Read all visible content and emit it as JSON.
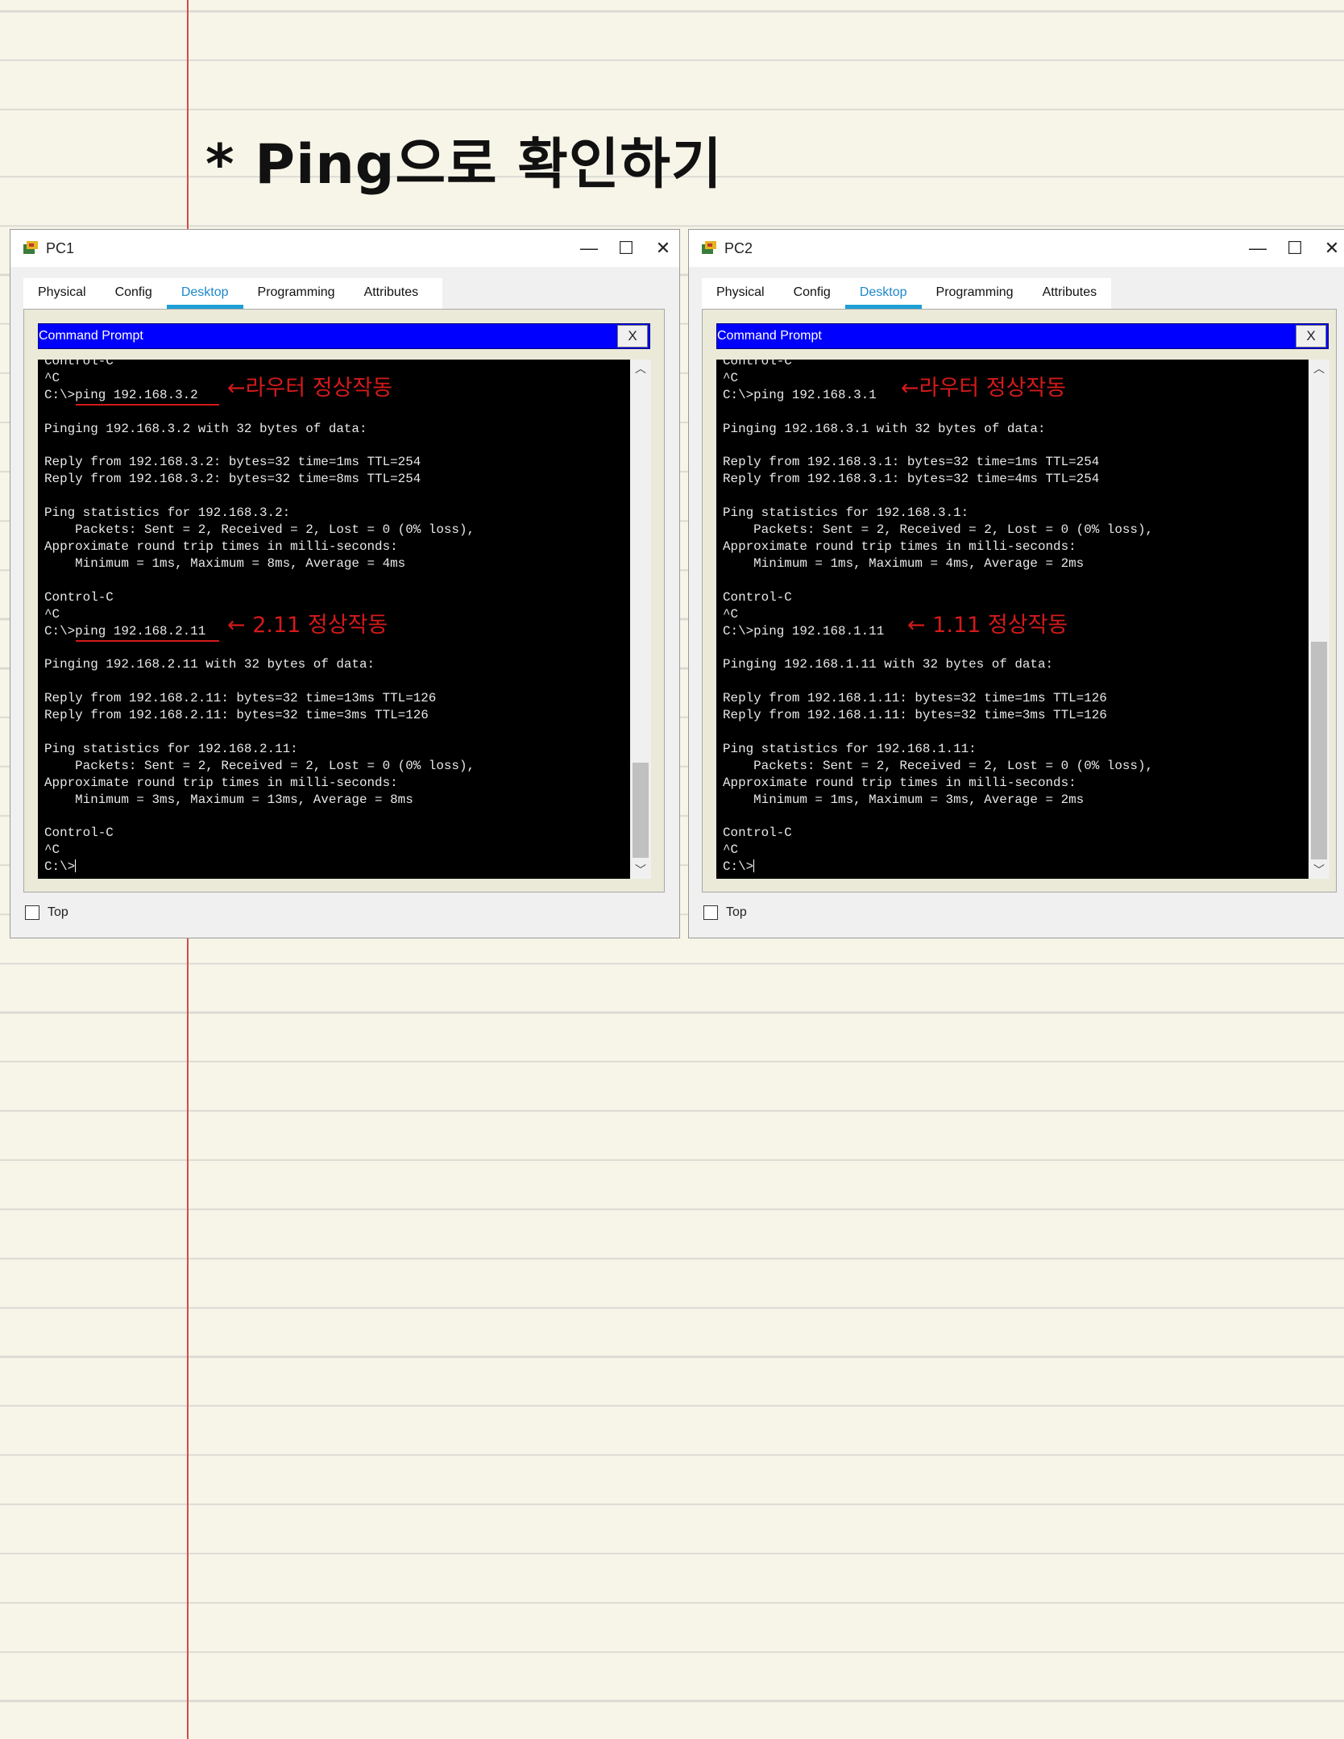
{
  "page": {
    "title": "* Ping으로 확인하기"
  },
  "windows": [
    {
      "title": "PC1",
      "tabs": [
        "Physical",
        "Config",
        "Desktop",
        "Programming",
        "Attributes"
      ],
      "active_tab": "Desktop",
      "cmd_title": "Command Prompt",
      "cmd_close": "X",
      "terminal": "Control-C\n^C\nC:\\>ping 192.168.3.2\n\nPinging 192.168.3.2 with 32 bytes of data:\n\nReply from 192.168.3.2: bytes=32 time=1ms TTL=254\nReply from 192.168.3.2: bytes=32 time=8ms TTL=254\n\nPing statistics for 192.168.3.2:\n    Packets: Sent = 2, Received = 2, Lost = 0 (0% loss),\nApproximate round trip times in milli-seconds:\n    Minimum = 1ms, Maximum = 8ms, Average = 4ms\n\nControl-C\n^C\nC:\\>ping 192.168.2.11\n\nPinging 192.168.2.11 with 32 bytes of data:\n\nReply from 192.168.2.11: bytes=32 time=13ms TTL=126\nReply from 192.168.2.11: bytes=32 time=3ms TTL=126\n\nPing statistics for 192.168.2.11:\n    Packets: Sent = 2, Received = 2, Lost = 0 (0% loss),\nApproximate round trip times in milli-seconds:\n    Minimum = 3ms, Maximum = 13ms, Average = 8ms\n\nControl-C\n^C\nC:\\>",
      "notes": [
        "←라우터 정상작동",
        "← 2.11 정상작동"
      ],
      "top_label": "Top"
    },
    {
      "title": "PC2",
      "tabs": [
        "Physical",
        "Config",
        "Desktop",
        "Programming",
        "Attributes"
      ],
      "active_tab": "Desktop",
      "cmd_title": "Command Prompt",
      "cmd_close": "X",
      "terminal": "Control-C\n^C\nC:\\>ping 192.168.3.1\n\nPinging 192.168.3.1 with 32 bytes of data:\n\nReply from 192.168.3.1: bytes=32 time=1ms TTL=254\nReply from 192.168.3.1: bytes=32 time=4ms TTL=254\n\nPing statistics for 192.168.3.1:\n    Packets: Sent = 2, Received = 2, Lost = 0 (0% loss),\nApproximate round trip times in milli-seconds:\n    Minimum = 1ms, Maximum = 4ms, Average = 2ms\n\nControl-C\n^C\nC:\\>ping 192.168.1.11\n\nPinging 192.168.1.11 with 32 bytes of data:\n\nReply from 192.168.1.11: bytes=32 time=1ms TTL=126\nReply from 192.168.1.11: bytes=32 time=3ms TTL=126\n\nPing statistics for 192.168.1.11:\n    Packets: Sent = 2, Received = 2, Lost = 0 (0% loss),\nApproximate round trip times in milli-seconds:\n    Minimum = 1ms, Maximum = 3ms, Average = 2ms\n\nControl-C\n^C\nC:\\>",
      "notes": [
        "←라우터 정상작동",
        "← 1.11 정상작동"
      ],
      "top_label": "Top"
    }
  ],
  "colors": {
    "note_red": "#d41a1a",
    "cmd_bar": "#0000ff",
    "terminal_bg": "#000000",
    "active_tab": "#1e9fd6"
  }
}
